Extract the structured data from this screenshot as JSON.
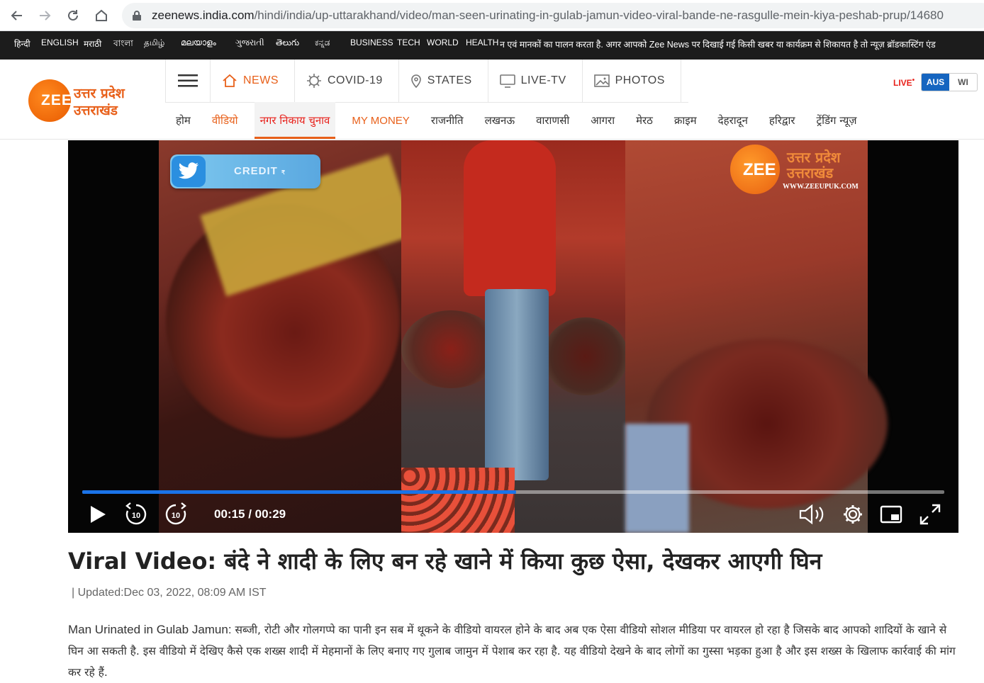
{
  "browser": {
    "url_host": "zeenews.india.com",
    "url_path": "/hindi/india/up-uttarakhand/video/man-seen-urinating-in-gulab-jamun-video-viral-bande-ne-rasgulle-mein-kiya-peshab-prup/14680"
  },
  "langbar": {
    "items": [
      "हिन्दी",
      "ENGLISH",
      "मराठी",
      "বাংলা",
      "தமிழ்",
      "മലയാളം",
      "ગુજરાતી",
      "తెలుగు",
      "ಕನ್ನಡ",
      "BUSINESS",
      "TECH",
      "WORLD",
      "HEALTH"
    ],
    "ticker": "न एवं मानकों का पालन करता है. अगर आपको Zee News पर दिखाई गई किसी खबर या कार्यक्रम से शिकायत है तो न्यूज़ ब्रॉडकास्टिंग एंड"
  },
  "logo": {
    "mark": "ZEE",
    "line1": "उत्तर प्रदेश",
    "line2": "उत्तराखंड"
  },
  "mainnav": {
    "items": [
      {
        "label": "NEWS",
        "icon": "home-icon"
      },
      {
        "label": "COVID-19",
        "icon": "virus-icon"
      },
      {
        "label": "STATES",
        "icon": "map-pin-icon"
      },
      {
        "label": "LIVE-TV",
        "icon": "tv-icon"
      },
      {
        "label": "PHOTOS",
        "icon": "photo-icon"
      }
    ]
  },
  "live": {
    "label": "LIVE",
    "team1": "AUS",
    "team2": "WI"
  },
  "subnav": {
    "items": [
      "होम",
      "वीडियो",
      "नगर निकाय चुनाव",
      "MY MONEY",
      "राजनीति",
      "लखनऊ",
      "वाराणसी",
      "आगरा",
      "मेरठ",
      "क्राइम",
      "देहरादून",
      "हरिद्वार",
      "ट्रेंडिंग न्यूज़"
    ]
  },
  "video": {
    "credit": "CREDIT",
    "credit_small": "₹",
    "watermark": {
      "mark": "ZEE",
      "line1": "उत्तर प्रदेश",
      "line2": "उत्तराखंड",
      "url": "WWW.ZEEUPUK.COM"
    },
    "progress": 0.503,
    "time": "00:15 / 00:29",
    "skip_seconds": "10"
  },
  "article": {
    "headline": "Viral Video: बंदे ने शादी के लिए बन रहे खाने में किया कुछ ऐसा, देखकर आएगी घिन",
    "updated": "| Updated:Dec 03, 2022, 08:09 AM IST",
    "summary_lead": "Man Urinated in Gulab Jamun:",
    "summary_body": " सब्जी, रोटी और गोलगप्पे का पानी इन सब में थूकने के वीडियो वायरल होने के बाद अब एक ऐसा वीडियो सोशल मीडिया पर वायरल हो रहा है जिसके बाद आपको शादियों के खाने से घिन आ सकती है. इस वीडियो में देखिए कैसे एक शख्स शादी में मेहमानों के लिए बनाए गए गुलाब जामुन में पेशाब कर रहा है. यह वीडियो देखने के बाद लोगों का गुस्सा भड़का हुआ है और इस शख्स के खिलाफ कार्रवाई की मांग कर रहे हैं."
  },
  "colors": {
    "accent": "#e8601a",
    "progress": "#1a73e8",
    "langbar_bg": "#1c1c1c"
  }
}
